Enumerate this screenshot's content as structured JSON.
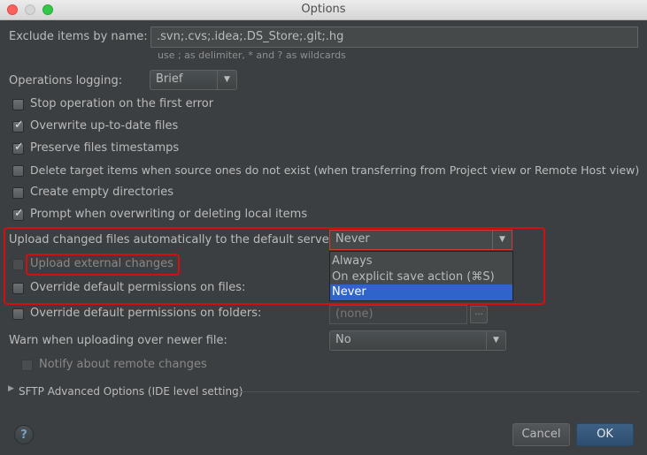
{
  "window": {
    "title": "Options"
  },
  "exclude": {
    "label": "Exclude items by name:",
    "value": ".svn;.cvs;.idea;.DS_Store;.git;.hg",
    "hint": "use ; as delimiter, * and ? as wildcards"
  },
  "logging": {
    "label": "Operations logging:",
    "value": "Brief"
  },
  "checkboxes": [
    {
      "label": "Stop operation on the first error",
      "checked": false
    },
    {
      "label": "Overwrite up-to-date files",
      "checked": true
    },
    {
      "label": "Preserve files timestamps",
      "checked": true
    },
    {
      "label": "Delete target items when source ones do not exist (when transferring from Project view or Remote Host view)",
      "checked": false
    },
    {
      "label": "Create empty directories",
      "checked": false
    },
    {
      "label": "Prompt when overwriting or deleting local items",
      "checked": true
    }
  ],
  "upload": {
    "label": "Upload changed files automatically to the default server",
    "value": "Never",
    "options": [
      "Always",
      "On explicit save action (⌘S)",
      "Never"
    ],
    "selected_index": 2
  },
  "upload_external": {
    "label": "Upload external changes",
    "checked": false
  },
  "override_files": {
    "label": "Override default permissions on files:"
  },
  "override_folders": {
    "label": "Override default permissions on folders:",
    "value": "(none)",
    "button": "..."
  },
  "warn": {
    "label": "Warn when uploading over newer file:",
    "value": "No"
  },
  "notify": {
    "label": "Notify about remote changes",
    "checked": false
  },
  "sftp": {
    "label": "SFTP Advanced Options (IDE level setting)"
  },
  "footer": {
    "help": "?",
    "cancel": "Cancel",
    "ok": "OK"
  },
  "colors": {
    "background": "#3c3f41",
    "selection": "#2f65ca",
    "highlight": "#d40f0f",
    "ok_button": "#365880"
  }
}
